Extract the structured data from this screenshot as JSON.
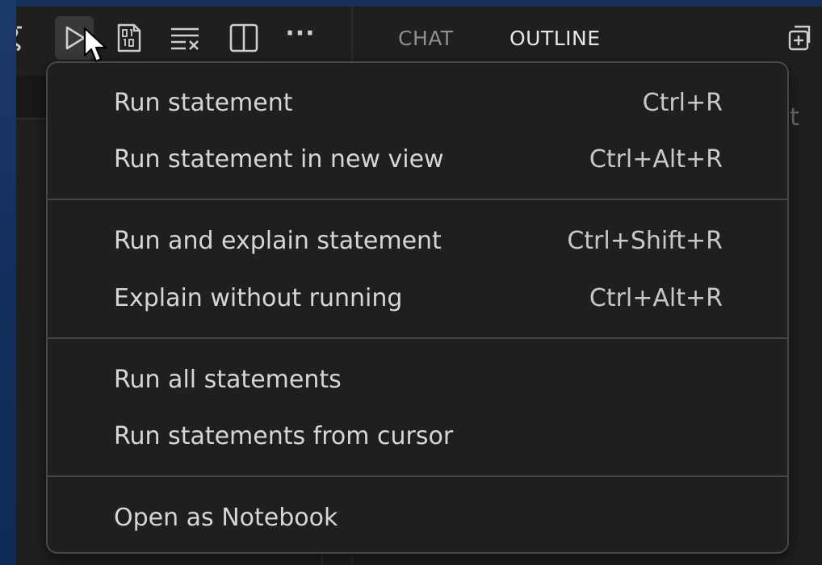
{
  "toolbar": {
    "icons": [
      "partial-tool-icon",
      "play-icon",
      "binary-icon",
      "clear-list-icon",
      "split-editor-icon",
      "more-icon"
    ],
    "more_glyph": "···",
    "panel_tabs": [
      {
        "label": "CHAT",
        "active": false
      },
      {
        "label": "OUTLINE",
        "active": true
      }
    ],
    "right_icon": "new-window-icon"
  },
  "background_hint": "t",
  "menu": {
    "groups": [
      [
        {
          "label": "Run statement",
          "shortcut": "Ctrl+R"
        },
        {
          "label": "Run statement in new view",
          "shortcut": "Ctrl+Alt+R"
        }
      ],
      [
        {
          "label": "Run and explain statement",
          "shortcut": "Ctrl+Shift+R"
        },
        {
          "label": "Explain without running",
          "shortcut": "Ctrl+Alt+R"
        }
      ],
      [
        {
          "label": "Run all statements",
          "shortcut": ""
        },
        {
          "label": "Run statements from cursor",
          "shortcut": ""
        }
      ],
      [
        {
          "label": "Open as Notebook",
          "shortcut": ""
        }
      ]
    ]
  },
  "colors": {
    "desktop": "#16305a",
    "window": "#1f1f1f",
    "menu_bg": "#1f1f1f",
    "menu_border": "#474747",
    "text": "#d6d6d6",
    "active_button_bg": "#383838"
  }
}
